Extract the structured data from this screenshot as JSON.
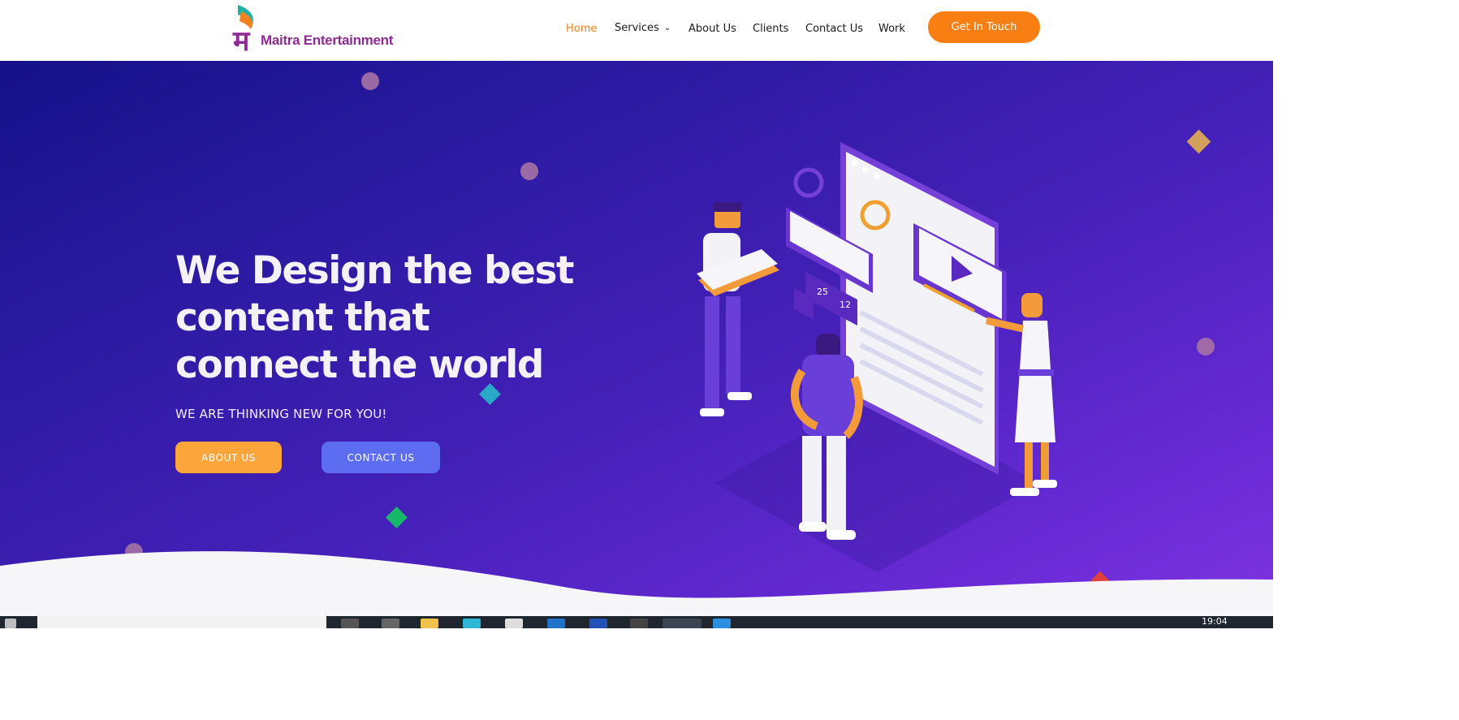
{
  "header": {
    "logo_text": "Maitra Entertainment",
    "logo_glyph": "म",
    "nav": [
      {
        "label": "Home",
        "active": true
      },
      {
        "label": "Services",
        "has_dropdown": true
      },
      {
        "label": "About Us"
      },
      {
        "label": "Clients"
      },
      {
        "label": "Contact Us"
      },
      {
        "label": "Work"
      }
    ],
    "cta_label": "Get In Touch"
  },
  "hero": {
    "title": "We Design the best content that connect the world",
    "subtitle": "WE ARE THINKING NEW FOR YOU!",
    "about_button": "ABOUT US",
    "contact_button": "CONTACT US",
    "illustration_labels": {
      "likes": "25",
      "comments": "12"
    }
  },
  "taskbar": {
    "clock": "19:04"
  },
  "colors": {
    "accent_orange": "#f97f13",
    "hero_gradient_start": "#15118a",
    "hero_gradient_end": "#7d33e0",
    "about_button": "#fba53a",
    "contact_button": "#5c6df2",
    "logo_purple": "#8e2a93"
  }
}
